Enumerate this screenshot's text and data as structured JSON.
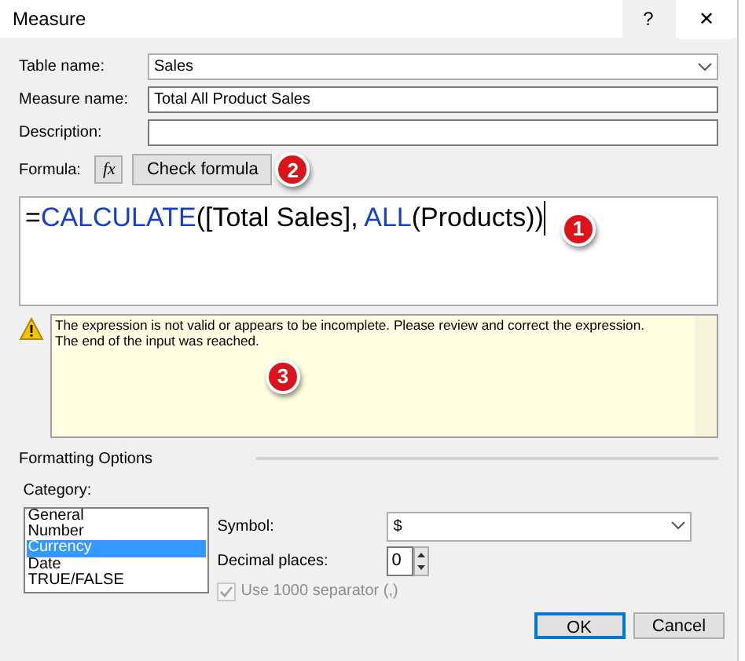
{
  "window": {
    "title": "Measure",
    "help": "?",
    "close": "✕"
  },
  "fields": [
    {
      "label": "Table name:",
      "kind": "dropdown",
      "value": "Sales"
    },
    {
      "label": "Measure name:",
      "kind": "text",
      "value": "Total All Product Sales"
    },
    {
      "label": "Description:",
      "kind": "text"
    }
  ],
  "formula": {
    "label": "Formula:",
    "fx": "fx",
    "check_button": "Check formula",
    "callout": "2",
    "tokens": [
      {
        "text": "=",
        "kind": "plain"
      },
      {
        "text": "CALCULATE",
        "kind": "function"
      },
      {
        "text": "([Total Sales], ",
        "kind": "plain"
      },
      {
        "text": "ALL",
        "kind": "function"
      },
      {
        "text": "(Products))",
        "kind": "plain"
      }
    ],
    "callout_editor": "1"
  },
  "message": {
    "lines": [
      "The expression is not valid or appears to be incomplete. Please review and correct the expression.",
      "The end of the input was reached."
    ],
    "callout": "3"
  },
  "formatting": {
    "title": "Formatting Options",
    "category_label": "Category:",
    "categories": [
      {
        "label": "General",
        "selected": false
      },
      {
        "label": "Number",
        "selected": false
      },
      {
        "label": "Currency",
        "selected": true
      },
      {
        "label": "Date",
        "selected": false
      },
      {
        "label": "TRUE/FALSE",
        "selected": false
      }
    ],
    "symbol_label": "Symbol:",
    "symbol": "$",
    "decimal_label": "Decimal places:",
    "decimal": "0",
    "separator": {
      "label": "Use 1000 separator (,)",
      "checked": true,
      "disabled": true
    }
  },
  "buttons": [
    {
      "label": "OK",
      "default": true
    },
    {
      "label": "Cancel",
      "default": false
    }
  ]
}
